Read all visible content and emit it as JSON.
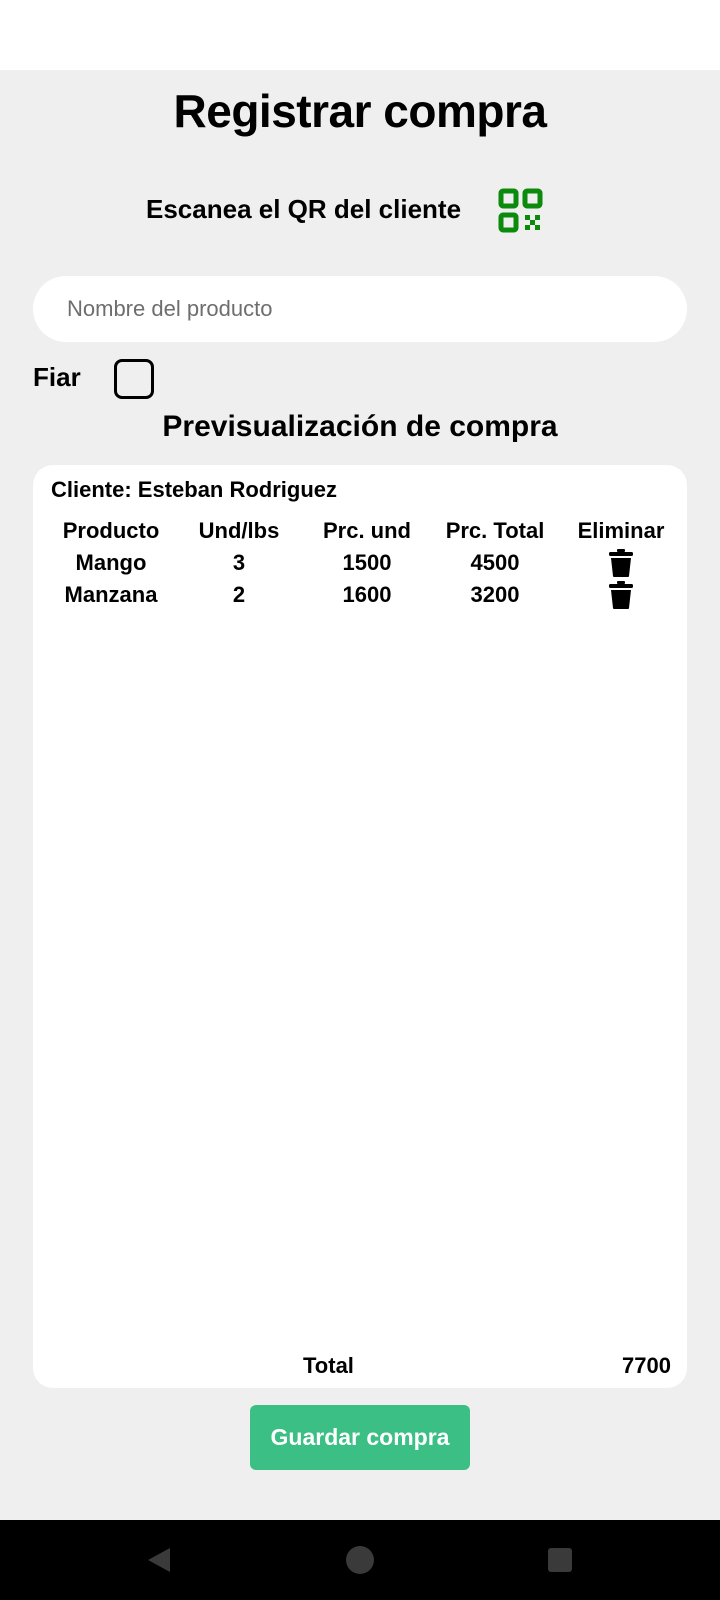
{
  "page": {
    "title": "Registrar compra",
    "scan_label": "Escanea el QR del cliente",
    "qr_icon": "qr-code-icon",
    "accent_color": "#0b8a0b"
  },
  "search": {
    "placeholder": "Nombre del producto",
    "value": ""
  },
  "fiar": {
    "label": "Fiar",
    "checked": false
  },
  "preview": {
    "title": "Previsualización de compra",
    "client": "Cliente: Esteban Rodriguez",
    "headers": [
      "Producto",
      "Und/lbs",
      "Prc. und",
      "Prc. Total",
      "Eliminar"
    ],
    "rows": [
      {
        "producto": "Mango",
        "und": "3",
        "prc_und": "1500",
        "prc_total": "4500"
      },
      {
        "producto": "Manzana",
        "und": "2",
        "prc_und": "1600",
        "prc_total": "3200"
      }
    ],
    "delete_icon": "trash-icon",
    "total_label": "Total",
    "total_value": "7700"
  },
  "actions": {
    "save_label": "Guardar compra",
    "save_color": "#3bbf85"
  },
  "nav": {
    "back_icon": "back-triangle-icon",
    "home_icon": "home-circle-icon",
    "recent_icon": "recents-square-icon"
  }
}
